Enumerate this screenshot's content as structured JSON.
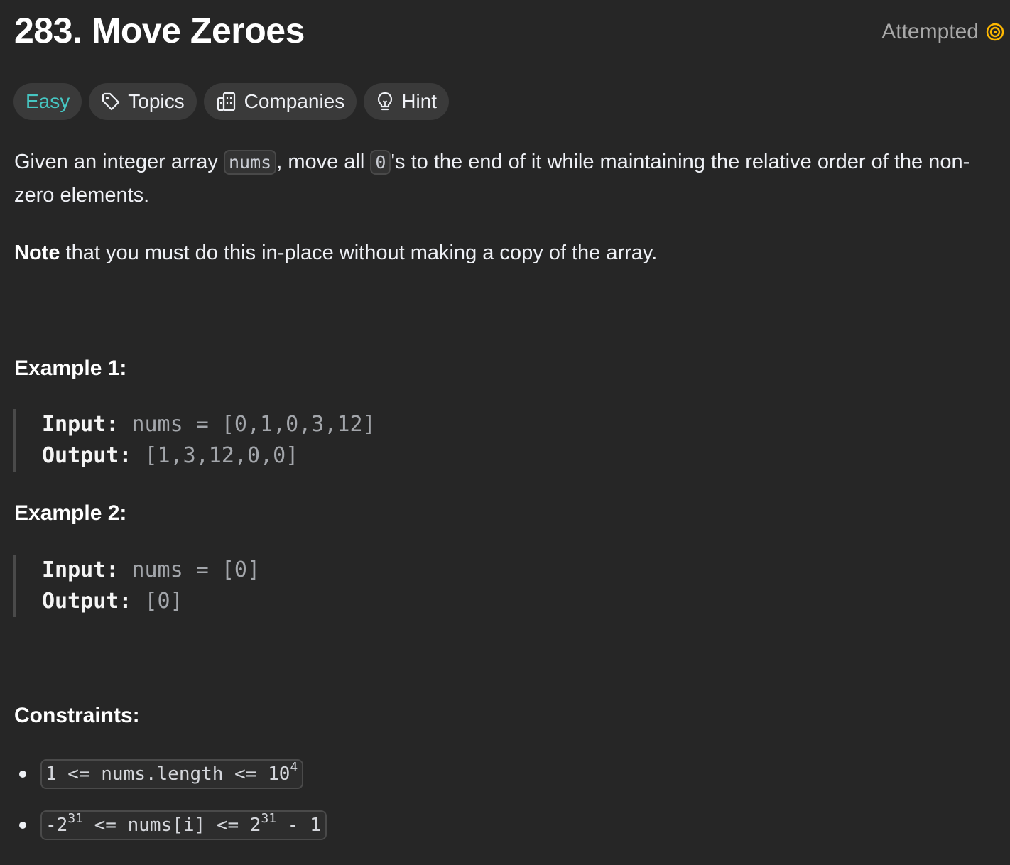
{
  "problem": {
    "title": "283. Move Zeroes",
    "status": "Attempted"
  },
  "tags": {
    "difficulty": "Easy",
    "topics": "Topics",
    "companies": "Companies",
    "hint": "Hint"
  },
  "description": {
    "p1_a": "Given an integer array ",
    "p1_code1": "nums",
    "p1_b": ", move all ",
    "p1_code2": "0",
    "p1_c": "'s to the end of it while maintaining the relative order of the non-zero elements.",
    "note_bold": "Note",
    "note_rest": " that you must do this in-place without making a copy of the array."
  },
  "examples": [
    {
      "heading": "Example 1:",
      "input_label": "Input:",
      "input_value": " nums = [0,1,0,3,12]",
      "output_label": "Output:",
      "output_value": " [1,3,12,0,0]"
    },
    {
      "heading": "Example 2:",
      "input_label": "Input:",
      "input_value": " nums = [0]",
      "output_label": "Output:",
      "output_value": " [0]"
    }
  ],
  "constraints": {
    "heading": "Constraints:",
    "c1_a": "1 <= nums.length <= 10",
    "c1_exp": "4",
    "c2_a": "-2",
    "c2_exp1": "31",
    "c2_b": " <= nums[i] <= 2",
    "c2_exp2": "31",
    "c2_c": " - 1"
  },
  "colors": {
    "background": "#262626",
    "easy": "#46c6c2",
    "attempted_icon": "#ffb800"
  },
  "icons": {
    "status": "attempted-target-icon",
    "topics": "tag-icon",
    "companies": "building-icon",
    "hint": "lightbulb-icon"
  }
}
